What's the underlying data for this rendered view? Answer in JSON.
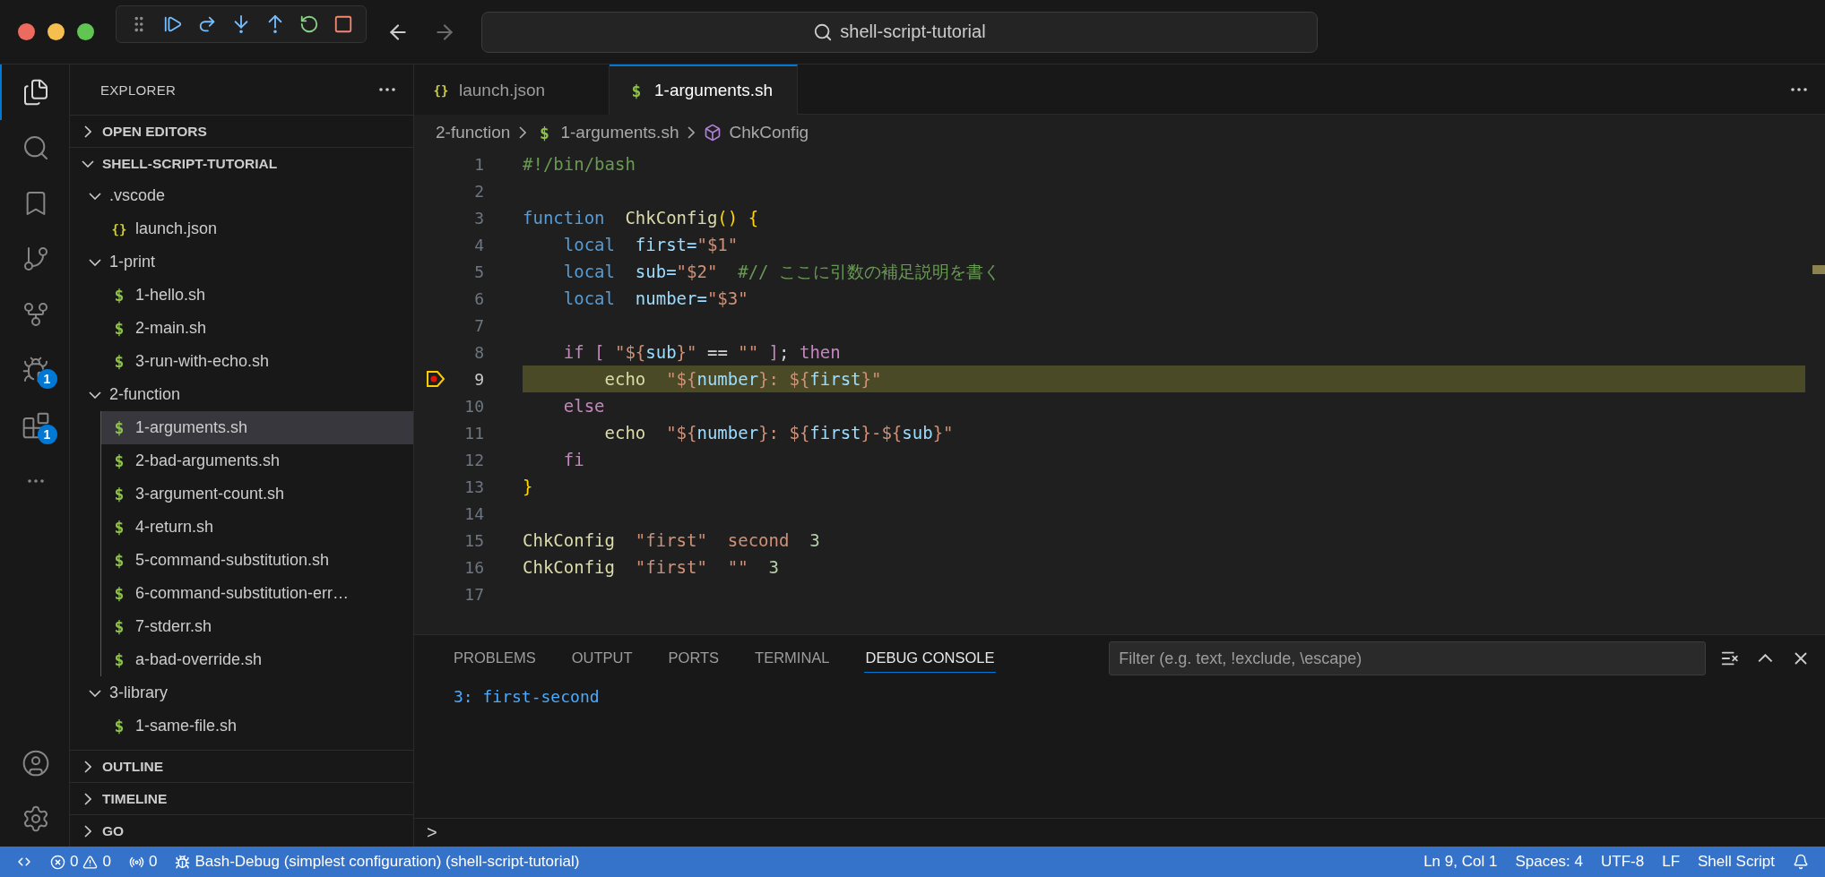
{
  "title_bar": {
    "search": "shell-script-tutorial",
    "debug_toolbar": [
      {
        "kind": "grip"
      },
      {
        "kind": "continue"
      },
      {
        "kind": "step_over"
      },
      {
        "kind": "step_into"
      },
      {
        "kind": "step_out"
      },
      {
        "kind": "restart"
      },
      {
        "kind": "stop"
      }
    ]
  },
  "activity_bar": {
    "top": [
      {
        "kind": "explorer",
        "selected": true
      },
      {
        "kind": "search",
        "selected": false
      },
      {
        "kind": "bookmarks",
        "selected": false
      },
      {
        "kind": "source_control",
        "selected": false
      },
      {
        "kind": "git_graph",
        "selected": false
      },
      {
        "kind": "run_debug",
        "selected": false,
        "badge": "1"
      },
      {
        "kind": "extensions",
        "selected": false,
        "badge": "1"
      },
      {
        "kind": "more",
        "selected": false
      }
    ],
    "bottom": [
      {
        "kind": "account"
      },
      {
        "kind": "settings"
      }
    ]
  },
  "sidebar": {
    "title": "EXPLORER",
    "sections": [
      {
        "label": "OPEN EDITORS",
        "expanded": false
      },
      {
        "label": "SHELL-SCRIPT-TUTORIAL",
        "expanded": true,
        "items": [
          {
            "label": ".vscode",
            "kind": "folder",
            "expanded": true,
            "selected": false,
            "children": [
              {
                "label": "launch.json",
                "kind": "json",
                "icon": "{}",
                "selected": false
              }
            ]
          },
          {
            "label": "1-print",
            "kind": "folder",
            "expanded": true,
            "selected": false,
            "children": [
              {
                "label": "1-hello.sh",
                "kind": "shell",
                "icon": "$",
                "selected": false
              },
              {
                "label": "2-main.sh",
                "kind": "shell",
                "icon": "$",
                "selected": false
              },
              {
                "label": "3-run-with-echo.sh",
                "kind": "shell",
                "icon": "$",
                "selected": false
              }
            ]
          },
          {
            "label": "2-function",
            "kind": "folder",
            "expanded": true,
            "selected": false,
            "children": [
              {
                "label": "1-arguments.sh",
                "kind": "shell",
                "icon": "$",
                "selected": true
              },
              {
                "label": "2-bad-arguments.sh",
                "kind": "shell",
                "icon": "$",
                "selected": false
              },
              {
                "label": "3-argument-count.sh",
                "kind": "shell",
                "icon": "$",
                "selected": false
              },
              {
                "label": "4-return.sh",
                "kind": "shell",
                "icon": "$",
                "selected": false
              },
              {
                "label": "5-command-substitution.sh",
                "kind": "shell",
                "icon": "$",
                "selected": false
              },
              {
                "label": "6-command-substitution-err…",
                "kind": "shell",
                "icon": "$",
                "selected": false
              },
              {
                "label": "7-stderr.sh",
                "kind": "shell",
                "icon": "$",
                "selected": false
              },
              {
                "label": "a-bad-override.sh",
                "kind": "shell",
                "icon": "$",
                "selected": false
              }
            ]
          },
          {
            "label": "3-library",
            "kind": "folder",
            "expanded": true,
            "selected": false,
            "children": [
              {
                "label": "1-same-file.sh",
                "kind": "shell",
                "icon": "$",
                "selected": false
              }
            ]
          }
        ]
      },
      {
        "label": "OUTLINE",
        "expanded": false
      },
      {
        "label": "TIMELINE",
        "expanded": false
      },
      {
        "label": "GO",
        "expanded": false
      }
    ]
  },
  "editor": {
    "tabs": [
      {
        "label": "launch.json",
        "kind": "json",
        "icon": "{}",
        "selected": false
      },
      {
        "label": "1-arguments.sh",
        "kind": "shell",
        "icon": "$",
        "selected": true
      }
    ],
    "breadcrumbs": [
      {
        "label": "2-function",
        "kind": "folder"
      },
      {
        "label": "1-arguments.sh",
        "kind": "shell",
        "icon": "$"
      },
      {
        "label": "ChkConfig",
        "kind": "symbol"
      }
    ],
    "lines": [
      {
        "number": "1",
        "current": false,
        "tokens": [
          {
            "kind": "comment",
            "text": "#!/bin/bash"
          }
        ]
      },
      {
        "number": "2",
        "current": false
      },
      {
        "number": "3",
        "current": false,
        "tokens": [
          {
            "kind": "keyword",
            "text": "function"
          },
          {
            "kind": "func",
            "text": "  ChkConfig"
          },
          {
            "kind": "brace",
            "text": "() {"
          }
        ]
      },
      {
        "number": "4",
        "current": false,
        "tokens": [
          {
            "kind": "keyword",
            "text": "    local"
          },
          {
            "kind": "var",
            "text": "  first="
          },
          {
            "kind": "string",
            "text": "\"$1\""
          }
        ]
      },
      {
        "number": "5",
        "current": false,
        "tokens": [
          {
            "kind": "keyword",
            "text": "    local"
          },
          {
            "kind": "var",
            "text": "  sub="
          },
          {
            "kind": "string",
            "text": "\"$2\""
          },
          {
            "kind": "comment",
            "text": "  #// ここに引数の補足説明を書く"
          }
        ]
      },
      {
        "number": "6",
        "current": false,
        "tokens": [
          {
            "kind": "keyword",
            "text": "    local"
          },
          {
            "kind": "var",
            "text": "  number="
          },
          {
            "kind": "string",
            "text": "\"$3\""
          }
        ]
      },
      {
        "number": "7",
        "current": false
      },
      {
        "number": "8",
        "current": false,
        "tokens": [
          {
            "kind": "control",
            "text": "    if ["
          },
          {
            "kind": "string",
            "text": " \"${"
          },
          {
            "kind": "var",
            "text": "sub"
          },
          {
            "kind": "string",
            "text": "}\""
          },
          {
            "kind": "plain",
            "text": " == "
          },
          {
            "kind": "string",
            "text": "\"\""
          },
          {
            "kind": "control",
            "text": " ]"
          },
          {
            "kind": "plain",
            "text": ";"
          },
          {
            "kind": "control",
            "text": " then"
          }
        ]
      },
      {
        "number": "9",
        "current": true,
        "tokens": [
          {
            "kind": "func",
            "text": "        echo"
          },
          {
            "kind": "string",
            "text": "  \"${"
          },
          {
            "kind": "var",
            "text": "number"
          },
          {
            "kind": "string",
            "text": "}: ${"
          },
          {
            "kind": "var",
            "text": "first"
          },
          {
            "kind": "string",
            "text": "}\""
          }
        ]
      },
      {
        "number": "10",
        "current": false,
        "tokens": [
          {
            "kind": "control",
            "text": "    else"
          }
        ]
      },
      {
        "number": "11",
        "current": false,
        "tokens": [
          {
            "kind": "func",
            "text": "        echo"
          },
          {
            "kind": "string",
            "text": "  \"${"
          },
          {
            "kind": "var",
            "text": "number"
          },
          {
            "kind": "string",
            "text": "}: ${"
          },
          {
            "kind": "var",
            "text": "first"
          },
          {
            "kind": "string",
            "text": "}-${"
          },
          {
            "kind": "var",
            "text": "sub"
          },
          {
            "kind": "string",
            "text": "}\""
          }
        ]
      },
      {
        "number": "12",
        "current": false,
        "tokens": [
          {
            "kind": "control",
            "text": "    fi"
          }
        ]
      },
      {
        "number": "13",
        "current": false,
        "tokens": [
          {
            "kind": "brace",
            "text": "}"
          }
        ]
      },
      {
        "number": "14",
        "current": false
      },
      {
        "number": "15",
        "current": false,
        "tokens": [
          {
            "kind": "func",
            "text": "ChkConfig"
          },
          {
            "kind": "string",
            "text": "  \"first\""
          },
          {
            "kind": "string",
            "text": "  second"
          },
          {
            "kind": "number",
            "text": "  3"
          }
        ]
      },
      {
        "number": "16",
        "current": false,
        "tokens": [
          {
            "kind": "func",
            "text": "ChkConfig"
          },
          {
            "kind": "string",
            "text": "  \"first\""
          },
          {
            "kind": "string",
            "text": "  \"\""
          },
          {
            "kind": "number",
            "text": "  3"
          }
        ]
      },
      {
        "number": "17",
        "current": false
      }
    ]
  },
  "panel": {
    "tabs": [
      {
        "label": "PROBLEMS",
        "selected": false
      },
      {
        "label": "OUTPUT",
        "selected": false
      },
      {
        "label": "PORTS",
        "selected": false
      },
      {
        "label": "TERMINAL",
        "selected": false
      },
      {
        "label": "DEBUG CONSOLE",
        "selected": true
      }
    ],
    "filter": {
      "placeholder": "Filter (e.g. text, !exclude, \\escape)"
    },
    "output": [
      "3: first-second"
    ],
    "prompt": ">"
  },
  "status_bar": {
    "errors": "0",
    "warnings": "0",
    "ports": "0",
    "debug": "Bash-Debug (simplest configuration) (shell-script-tutorial)",
    "right": [
      "Ln 9, Col 1",
      "Spaces: 4",
      "UTF-8",
      "LF",
      "Shell Script"
    ]
  }
}
